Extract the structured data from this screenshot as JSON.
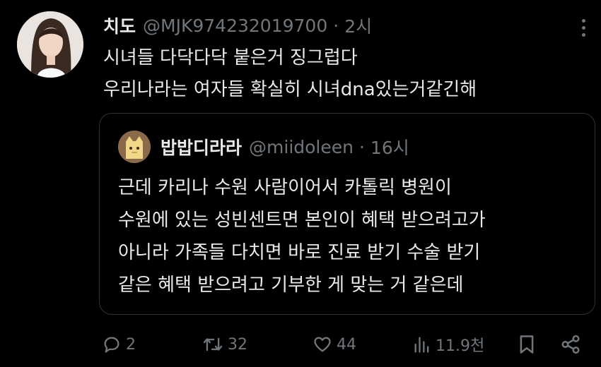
{
  "tweet": {
    "display_name": "치도",
    "handle": "@MJK974232019700",
    "separator": "·",
    "time": "2시",
    "lines": [
      "시녀들 다닥다닥 붙은거 징그럽다",
      "우리나라는 여자들 확실히 시녀dna있는거같긴해"
    ]
  },
  "quote": {
    "display_name": "밥밥디라라",
    "handle": "@miidoleen",
    "separator": "·",
    "time": "16시",
    "lines": [
      "근데 카리나 수원 사람이어서 카톨릭 병원이",
      "수원에 있는 성빈센트면 본인이 혜택 받으려고가",
      "아니라 가족들 다치면 바로 진료 받기 수술 받기",
      "같은 혜택 받으려고 기부한 게 맞는 거 같은데"
    ]
  },
  "actions": {
    "replies": "2",
    "reposts": "32",
    "likes": "44",
    "views": "11.9천"
  },
  "colors": {
    "background": "#000000",
    "text": "#e7e9ea",
    "secondary": "#71767b",
    "border": "#2f3336"
  },
  "icons": [
    "more-icon",
    "reply-icon",
    "repost-icon",
    "like-icon",
    "views-icon",
    "bookmark-icon",
    "share-icon"
  ]
}
